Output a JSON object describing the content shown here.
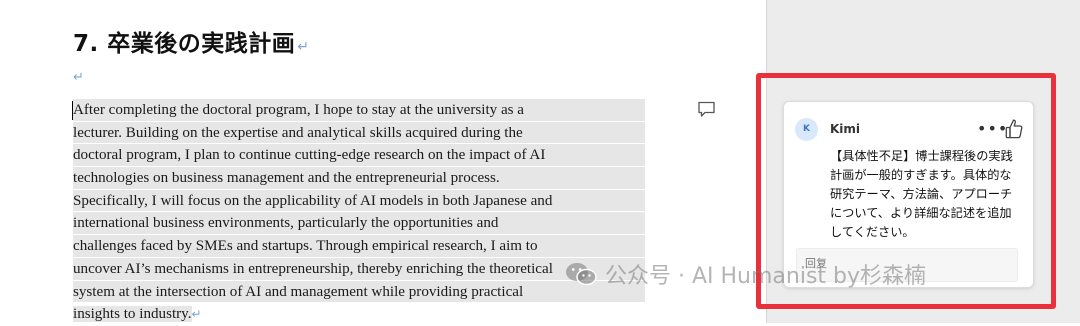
{
  "document": {
    "heading": "7. 卒業後の実践計画",
    "pilcrow": "↵",
    "body_lines": [
      "After completing the doctoral program, I hope to stay at the university as a",
      "lecturer. Building on the expertise and analytical skills acquired during the",
      "doctoral program, I plan to continue cutting-edge research on the impact of AI",
      "technologies on business management and the entrepreneurial process.",
      "Specifically, I will focus on the applicability of AI models in both Japanese and",
      "international business environments, particularly the opportunities and",
      "challenges faced by SMEs and startups. Through empirical research, I aim to",
      "uncover AI’s mechanisms in entrepreneurship, thereby enriching the theoretical",
      "system at the intersection of AI and management while providing practical",
      "insights to industry."
    ]
  },
  "comment": {
    "avatar_initial": "K",
    "author": "Kimi",
    "more_icon": "•••",
    "like_icon": "thumbs-up-icon",
    "text": "【具体性不足】博士課程後の実践計画が一般的すぎます。具体的な研究テーマ、方法論、アプローチについて、より詳細な記述を追加してください。",
    "reply_placeholder": "回复"
  },
  "watermark": {
    "text": "公众号 · AI Humanist by杉森楠"
  },
  "colors": {
    "highlight_frame": "#e8313a",
    "text_selection": "#e6e6e6",
    "avatar_bg": "#d9e8fa",
    "gutter": "#ececec"
  }
}
